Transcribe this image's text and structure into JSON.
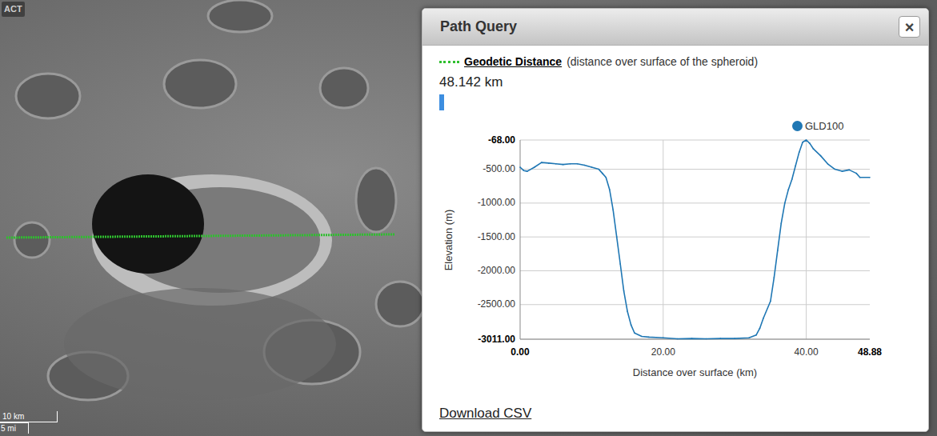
{
  "map": {
    "logo": "ACT",
    "scale": {
      "metric": "10 km",
      "imperial": "5 mi"
    }
  },
  "popup": {
    "title": "Path Query",
    "close": "×",
    "measure": {
      "label": "Geodetic Distance",
      "note": "(distance over surface of the spheroid)",
      "value": "48.142 km"
    },
    "chart": {
      "legend": [
        {
          "label": "GLD100",
          "color": "#1f77b4"
        }
      ],
      "y_axis": {
        "title": "Elevation (m)",
        "ticks": [
          {
            "label": "-68.00",
            "emphasis": true
          },
          {
            "label": "-500.00",
            "emphasis": false
          },
          {
            "label": "-1000.00",
            "emphasis": false
          },
          {
            "label": "-1500.00",
            "emphasis": false
          },
          {
            "label": "-2000.00",
            "emphasis": false
          },
          {
            "label": "-2500.00",
            "emphasis": false
          },
          {
            "label": "-3011.00",
            "emphasis": true
          }
        ]
      },
      "x_axis": {
        "title": "Distance over surface (km)",
        "ticks": [
          {
            "label": "0.00",
            "emphasis": true
          },
          {
            "label": "20.00",
            "emphasis": false
          },
          {
            "label": "40.00",
            "emphasis": false
          },
          {
            "label": "48.88",
            "emphasis": true
          }
        ]
      },
      "series": [
        {
          "name": "GLD100",
          "color": "#1f77b4",
          "distances": [
            0,
            0.5,
            1,
            2,
            3,
            4,
            5,
            6,
            7,
            8,
            9,
            10,
            11,
            11.5,
            12,
            12.5,
            13,
            13.5,
            14,
            14.5,
            15,
            15.5,
            16,
            17,
            18,
            20,
            22,
            24,
            26,
            28,
            30,
            32,
            33,
            33.5,
            34,
            35,
            35.5,
            36,
            36.5,
            37,
            37.5,
            38,
            38.5,
            39,
            39.5,
            40,
            40.5,
            41,
            42,
            43,
            44,
            45,
            46,
            47,
            47.5,
            48.88
          ],
          "elevations": [
            -470,
            -520,
            -530,
            -470,
            -400,
            -410,
            -420,
            -430,
            -420,
            -420,
            -440,
            -470,
            -500,
            -560,
            -620,
            -800,
            -1100,
            -1500,
            -1900,
            -2300,
            -2600,
            -2800,
            -2920,
            -2970,
            -2980,
            -2990,
            -3005,
            -3000,
            -3005,
            -3000,
            -3000,
            -2990,
            -2950,
            -2850,
            -2700,
            -2450,
            -2100,
            -1700,
            -1300,
            -1000,
            -800,
            -650,
            -450,
            -250,
            -100,
            -68,
            -120,
            -200,
            -300,
            -420,
            -500,
            -530,
            -510,
            -560,
            -620,
            -620
          ]
        }
      ]
    },
    "download": "Download CSV"
  }
}
